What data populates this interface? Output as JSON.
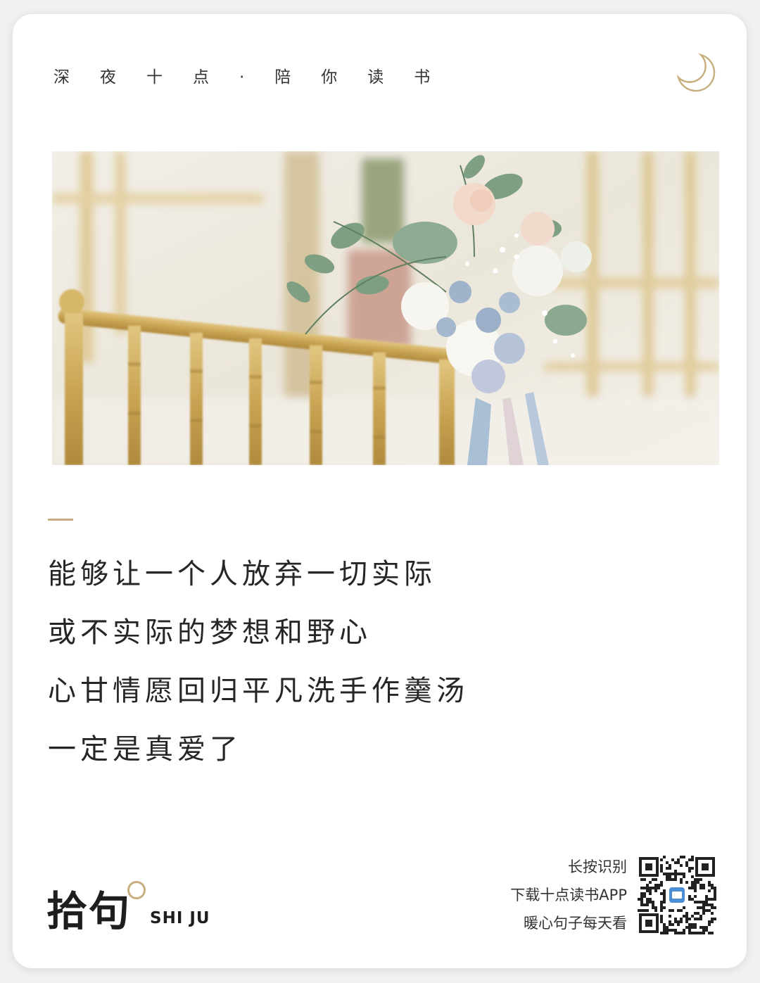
{
  "header": {
    "slogan": "深夜十点·陪你读书",
    "icon": "moon-icon",
    "accent_color": "#c7ae7e"
  },
  "photo": {
    "description_icon": "photo-image"
  },
  "quote": {
    "lines": [
      "能够让一个人放弃一切实际",
      "或不实际的梦想和野心",
      "心甘情愿回归平凡洗手作羹汤",
      "一定是真爱了"
    ]
  },
  "brand": {
    "name_cn": "拾句",
    "name_en": "SHI JU"
  },
  "promo": {
    "line1": "长按识别",
    "line2": "下载十点读书APP",
    "line3": "暖心句子每天看",
    "qr_icon": "qr-code-icon"
  }
}
